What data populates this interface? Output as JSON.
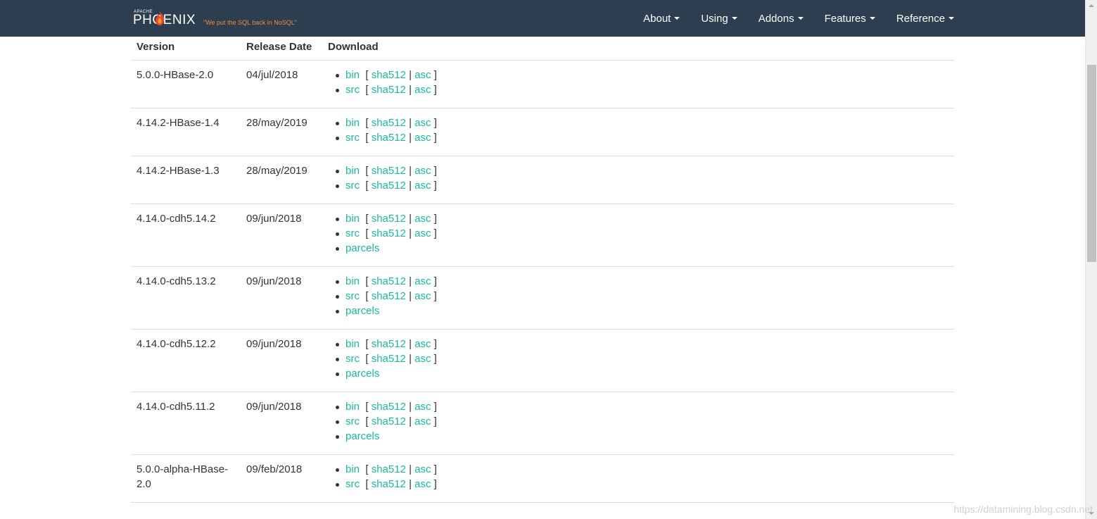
{
  "brand": {
    "apache": "APACHE",
    "name": "PHOENIX",
    "tagline": "\"We put the SQL back in NoSQL\"",
    "accent_color": "#f0883e",
    "logo_icon": "flame-icon"
  },
  "nav": {
    "items": [
      {
        "label": "About"
      },
      {
        "label": "Using"
      },
      {
        "label": "Addons"
      },
      {
        "label": "Features"
      },
      {
        "label": "Reference"
      }
    ]
  },
  "table": {
    "headers": {
      "version": "Version",
      "release_date": "Release Date",
      "download": "Download"
    },
    "link_labels": {
      "bin": "bin",
      "src": "src",
      "sha512": "sha512",
      "asc": "asc",
      "parcels": "parcels",
      "bracket_open": "[",
      "bracket_close": "]",
      "separator": "|"
    },
    "rows": [
      {
        "version": "5.0.0-HBase-2.0",
        "date": "04/jul/2018"
      },
      {
        "version": "4.14.2-HBase-1.4",
        "date": "28/may/2019"
      },
      {
        "version": "4.14.2-HBase-1.3",
        "date": "28/may/2019"
      },
      {
        "version": "4.14.0-cdh5.14.2",
        "date": "09/jun/2018"
      },
      {
        "version": "4.14.0-cdh5.13.2",
        "date": "09/jun/2018"
      },
      {
        "version": "4.14.0-cdh5.12.2",
        "date": "09/jun/2018"
      },
      {
        "version": "4.14.0-cdh5.11.2",
        "date": "09/jun/2018"
      },
      {
        "version": "5.0.0-alpha-HBase-2.0",
        "date": "09/feb/2018"
      }
    ]
  },
  "watermark": "https://datamining.blog.csdn.net",
  "colors": {
    "navbar_bg": "#2c3e50",
    "link": "#18bc9c"
  }
}
